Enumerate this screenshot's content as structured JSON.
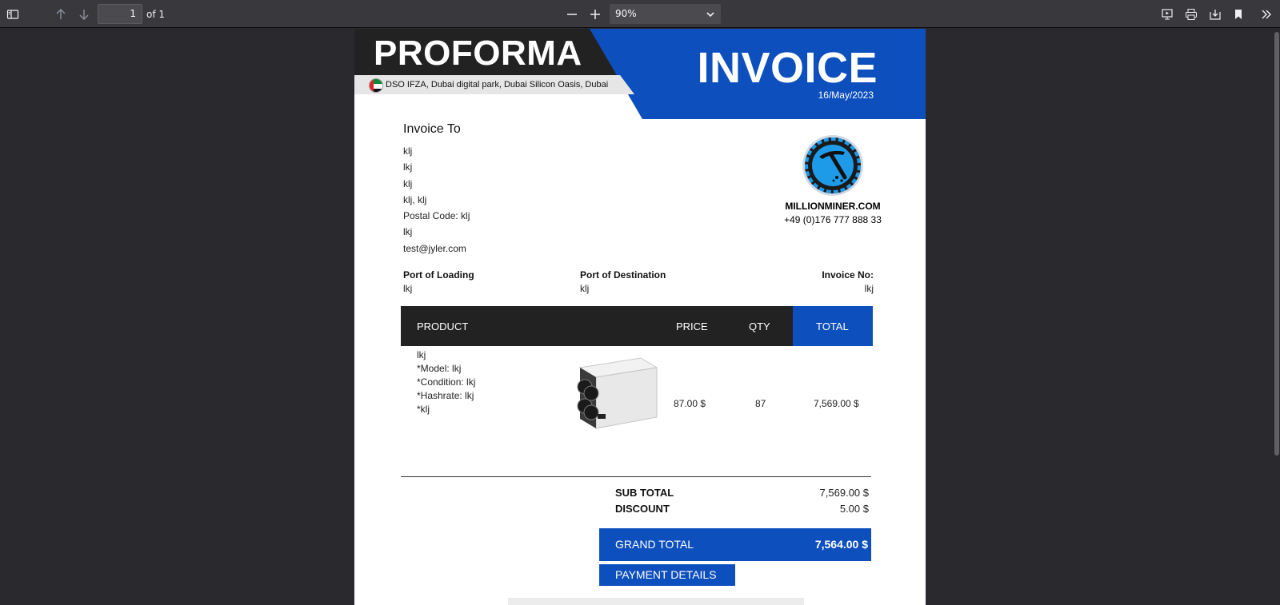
{
  "viewer": {
    "page_number": "1",
    "page_count_label": "of 1",
    "zoom": "90%",
    "icons": [
      "sidebar-toggle-icon",
      "arrow-up-icon",
      "arrow-down-icon",
      "zoom-out-icon",
      "zoom-in-icon",
      "chevron-down-icon",
      "presentation-icon",
      "print-icon",
      "download-icon",
      "bookmark-icon",
      "double-chevron-right-icon"
    ]
  },
  "invoice": {
    "proforma": "PROFORMA",
    "title": "INVOICE",
    "date": "16/May/2023",
    "address": "DSO IFZA, Dubai digital park, Dubai Silicon Oasis, Dubai",
    "invoice_to_title": "Invoice To",
    "invoice_to": [
      "klj",
      "lkj",
      "klj",
      "klj, klj",
      "Postal Code: klj",
      "lkj",
      "test@jyler.com"
    ],
    "brand_name": "MILLIONMINER.COM",
    "brand_phone": "+49 (0)176 777 888 33",
    "port_loading_label": "Port of Loading",
    "port_loading_value": "lkj",
    "port_destination_label": "Port of Destination",
    "port_destination_value": "klj",
    "invoice_no_label": "Invoice No:",
    "invoice_no_value": "lkj",
    "table_headers": {
      "product": "PRODUCT",
      "price": "PRICE",
      "qty": "QTY",
      "total": "TOTAL"
    },
    "item": {
      "lines": [
        "lkj",
        "*Model: lkj",
        "*Condition: lkj",
        "*Hashrate: lkj",
        "*klj"
      ],
      "price": "87.00 $",
      "qty": "87",
      "total": "7,569.00 $"
    },
    "subtotal_label": "SUB TOTAL",
    "subtotal_value": "7,569.00 $",
    "discount_label": "DISCOUNT",
    "discount_value": "5.00 $",
    "grand_total_label": "GRAND TOTAL",
    "grand_total_value": "7,564.00 $",
    "payment_details_label": "PAYMENT DETAILS"
  },
  "colors": {
    "accent_blue": "#0d4fbd",
    "header_dark": "#222222",
    "viewer_bg": "#2a2a2e",
    "toolbar_bg": "#38383d"
  }
}
